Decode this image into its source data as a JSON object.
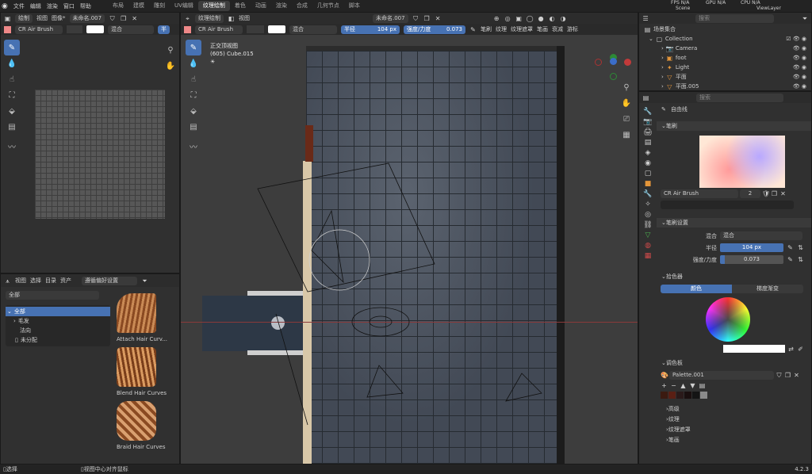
{
  "menu": [
    "文件",
    "编辑",
    "渲染",
    "窗口",
    "帮助"
  ],
  "workspaces": [
    {
      "label": "布局",
      "active": false
    },
    {
      "label": "建模",
      "active": false
    },
    {
      "label": "雕刻",
      "active": false
    },
    {
      "label": "UV编辑",
      "active": false
    },
    {
      "label": "纹理绘制",
      "active": true
    },
    {
      "label": "着色",
      "active": false
    },
    {
      "label": "动画",
      "active": false
    },
    {
      "label": "渲染",
      "active": false
    },
    {
      "label": "合成",
      "active": false
    },
    {
      "label": "几何节点",
      "active": false
    },
    {
      "label": "脚本",
      "active": false
    }
  ],
  "topright": {
    "fps": "FPS N/A",
    "gpu": "GPU N/A",
    "cpu": "CPU N/A",
    "scene": "Scene",
    "viewlayer": "ViewLayer"
  },
  "image_editor": {
    "mode": "绘制",
    "view": "视图",
    "image": "图像*",
    "image_name": "未命名.007",
    "brush": "CR Air Brush",
    "blend": "混合"
  },
  "viewport": {
    "mode": "纹理绘制",
    "view": "视图",
    "image_name": "未命名.007",
    "brush": "CR Air Brush",
    "blend": "混合",
    "radius_label": "半径",
    "radius_value": "104 px",
    "strength_label": "强度/力度",
    "strength_value": "0.073",
    "menus": [
      "笔刷",
      "纹理",
      "纹理遮罩",
      "笔画",
      "衰减",
      "游标"
    ],
    "view_name": "正交顶视图",
    "object_info": "(605) Cube.015"
  },
  "outliner": {
    "title": "场景集合",
    "search_placeholder": "搜索",
    "items": [
      "Collection",
      "Camera",
      "foot",
      "Light",
      "平面",
      "平面.005"
    ]
  },
  "asset_browser": {
    "menus": [
      "视图",
      "选择",
      "目录",
      "资产"
    ],
    "library": "遵循偏好设置",
    "filter": "全部",
    "tree": [
      "全部",
      "毛发",
      "法向",
      "未分配"
    ],
    "assets": [
      "Attach Hair Curv...",
      "Blend Hair Curves",
      "Braid Hair Curves"
    ]
  },
  "properties": {
    "search_placeholder": "搜索",
    "tool_name": "自由线",
    "brush_section": "笔刷",
    "brush_name": "CR Air Brush",
    "brush_users": "2",
    "brush_settings": "笔刷设置",
    "blend_label": "混合",
    "blend_value": "混合",
    "radius_label": "半径",
    "radius_value": "104 px",
    "strength_label": "强度/力度",
    "strength_value": "0.073",
    "color_picker": "拾色器",
    "tab_color": "颜色",
    "tab_gradient": "梯度渐变",
    "palette_section": "调色板",
    "palette_name": "Palette.001",
    "subsections": [
      "高级",
      "纹理",
      "纹理遮罩",
      "笔画"
    ],
    "palette_colors": [
      "#3b1a10",
      "#5a1f14",
      "#2a1a1a",
      "#1a0f0f",
      "#141414",
      "#8a8a8a"
    ]
  },
  "status": {
    "left": "选择",
    "middle": "视图中心对齐鼠标",
    "version": "4.2.3"
  }
}
